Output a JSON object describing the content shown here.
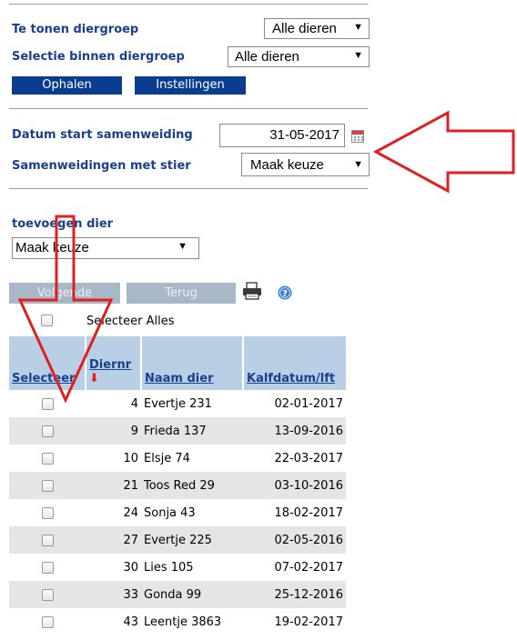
{
  "filters": {
    "diergroep_label": "Te tonen diergroep",
    "diergroep_value": "Alle dieren",
    "selectie_label": "Selectie binnen diergroep",
    "selectie_value": "Alle dieren",
    "ophalen": "Ophalen",
    "instellingen": "Instellingen"
  },
  "samenweiding": {
    "datum_label": "Datum start samenweiding",
    "datum_value": "31-05-2017",
    "stier_label": "Samenweidingen met stier",
    "stier_value": "Maak keuze"
  },
  "toevoegen": {
    "label": "toevoegen dier",
    "value": "Maak keuze"
  },
  "actions": {
    "volgende": "Volgende",
    "terug": "Terug",
    "print_icon": "printer-icon",
    "help_icon": "help-icon"
  },
  "select_all": "Selecteer Alles",
  "table": {
    "headers": [
      "Selecteer",
      "Diernr",
      "Naam dier",
      "Kalfdatum/lft"
    ],
    "rows": [
      {
        "nr": "4",
        "naam": "Evertje 231",
        "datum": "02-01-2017"
      },
      {
        "nr": "9",
        "naam": "Frieda 137",
        "datum": "13-09-2016"
      },
      {
        "nr": "10",
        "naam": "Elsje 74",
        "datum": "22-03-2017"
      },
      {
        "nr": "21",
        "naam": "Toos Red 29",
        "datum": "03-10-2016"
      },
      {
        "nr": "24",
        "naam": "Sonja 43",
        "datum": "18-02-2017"
      },
      {
        "nr": "27",
        "naam": "Evertje 225",
        "datum": "02-05-2016"
      },
      {
        "nr": "30",
        "naam": "Lies 105",
        "datum": "07-02-2017"
      },
      {
        "nr": "33",
        "naam": "Gonda 99",
        "datum": "25-12-2016"
      },
      {
        "nr": "43",
        "naam": "Leentje 3863",
        "datum": "19-02-2017"
      }
    ]
  },
  "colors": {
    "label_blue": "#1a3f8c",
    "button_blue": "#0a3d8f",
    "header_bg": "#b8cfe6",
    "annotation_red": "#e02020"
  }
}
